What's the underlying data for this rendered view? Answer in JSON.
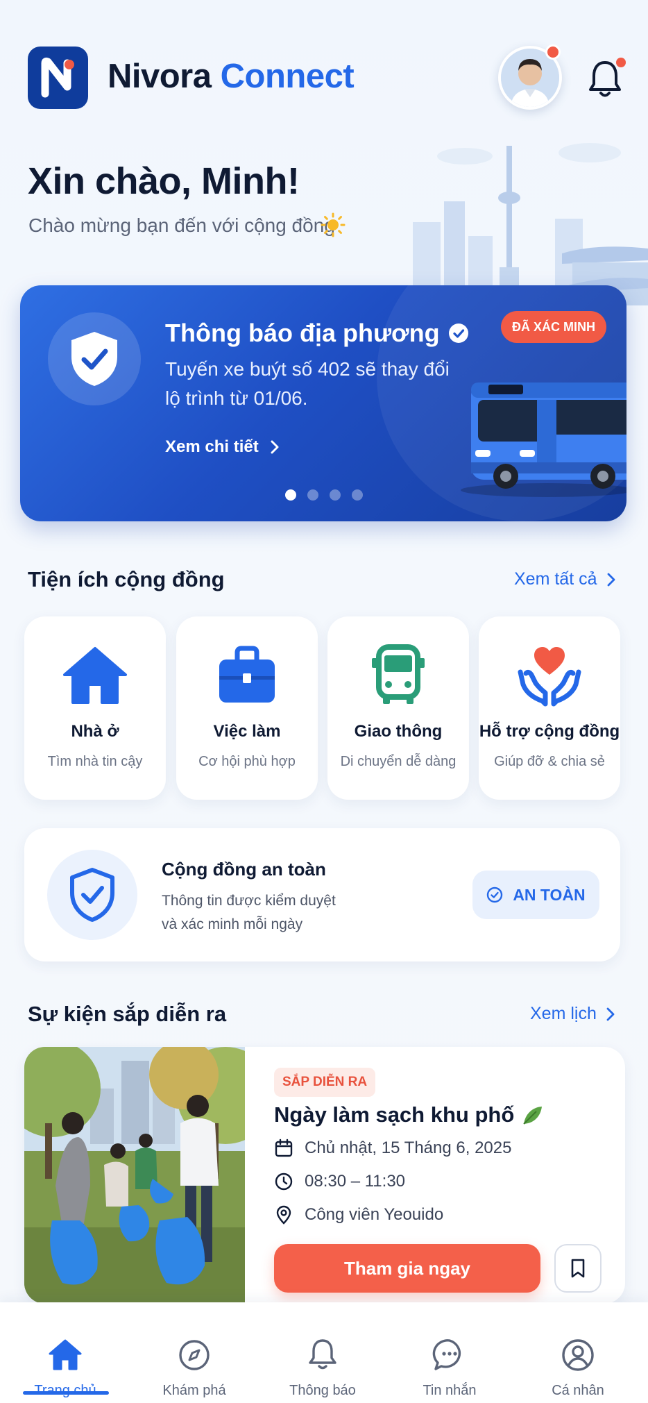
{
  "app": {
    "brand_part1": "Nivora",
    "brand_part2": "Connect",
    "accent_color": "#2468e8",
    "alert_color": "#f15a45"
  },
  "greeting": {
    "title": "Xin chào, Minh!",
    "subtitle": "Chào mừng bạn đến với cộng đồng",
    "subtitle_icon": "sun-icon"
  },
  "banner": {
    "title": "Thông báo địa phương",
    "badge": "ĐÃ XÁC MINH",
    "text": "Tuyến xe buýt số 402 sẽ thay đổi lộ trình từ 01/06.",
    "link": "Xem chi tiết",
    "slides_total": 4,
    "slide_active": 1
  },
  "utilities": {
    "title": "Tiện ích cộng đồng",
    "see_all": "Xem tất cả",
    "items": [
      {
        "label": "Nhà ở",
        "sub": "Tìm nhà tin cậy",
        "icon": "home-icon"
      },
      {
        "label": "Việc làm",
        "sub": "Cơ hội phù hợp",
        "icon": "briefcase-icon"
      },
      {
        "label": "Giao thông",
        "sub": "Di chuyển dễ dàng",
        "icon": "bus-icon"
      },
      {
        "label": "Hỗ trợ cộng đồng",
        "sub": "Giúp đỡ & chia sẻ",
        "icon": "heart-hands-icon"
      }
    ]
  },
  "safety": {
    "title": "Cộng đồng an toàn",
    "line1": "Thông tin được kiểm duyệt",
    "line2": "và xác minh mỗi ngày",
    "status": "AN TOÀN"
  },
  "events": {
    "title": "Sự kiện sắp diễn ra",
    "see_all": "Xem lịch",
    "item": {
      "tag": "SẮP DIỄN RA",
      "title": "Ngày làm sạch khu phố",
      "date": "Chủ nhật, 15 Tháng 6, 2025",
      "time": "08:30 – 11:30",
      "location": "Công viên Yeouido",
      "cta": "Tham gia ngay"
    }
  },
  "nav": {
    "items": [
      {
        "label": "Trang chủ",
        "icon": "home-icon",
        "active": true
      },
      {
        "label": "Khám phá",
        "icon": "compass-icon",
        "active": false
      },
      {
        "label": "Thông báo",
        "icon": "bell-icon",
        "active": false
      },
      {
        "label": "Tin nhắn",
        "icon": "chat-icon",
        "active": false
      },
      {
        "label": "Cá nhân",
        "icon": "user-icon",
        "active": false
      }
    ]
  }
}
